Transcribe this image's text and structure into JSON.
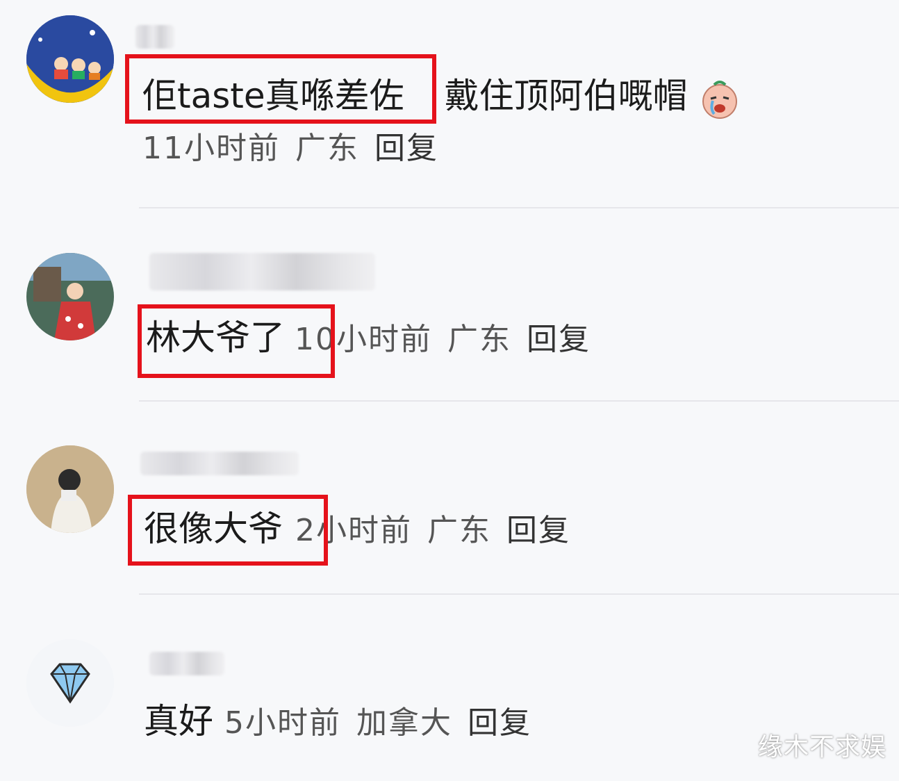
{
  "comments": [
    {
      "text": "佢taste真喺差佐",
      "text_more": "戴住顶阿伯嘅帽",
      "emoji_icon": "crying-face-icon",
      "time": "11小时前",
      "location": "广东",
      "reply": "回复"
    },
    {
      "text": "林大爷了",
      "time": "10小时前",
      "location": "广东",
      "reply": "回复"
    },
    {
      "text": "很像大爷",
      "time": "2小时前",
      "location": "广东",
      "reply": "回复"
    },
    {
      "text": "真好",
      "time": "5小时前",
      "location": "加拿大",
      "reply": "回复"
    }
  ],
  "highlight_color": "#e5121b",
  "watermark": "缘木不求娱"
}
